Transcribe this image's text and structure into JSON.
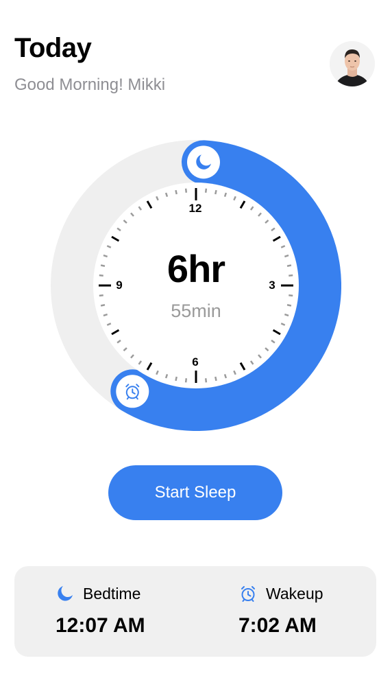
{
  "header": {
    "title": "Today",
    "greeting": "Good Morning! Mikki",
    "avatar_icon": "user-avatar"
  },
  "sleep_dial": {
    "duration_hours": "6hr",
    "duration_minutes": "55min",
    "clock_numbers": {
      "twelve": "12",
      "three": "3",
      "six": "6",
      "nine": "9"
    },
    "bedtime_icon": "moon-icon",
    "wakeup_icon": "alarm-clock-icon",
    "accent_color": "#3880ef",
    "track_color": "#efefef"
  },
  "actions": {
    "start_sleep_label": "Start Sleep"
  },
  "summary": {
    "bedtime_label": "Bedtime",
    "bedtime_value": "12:07 AM",
    "wakeup_label": "Wakeup",
    "wakeup_value": "7:02 AM"
  }
}
